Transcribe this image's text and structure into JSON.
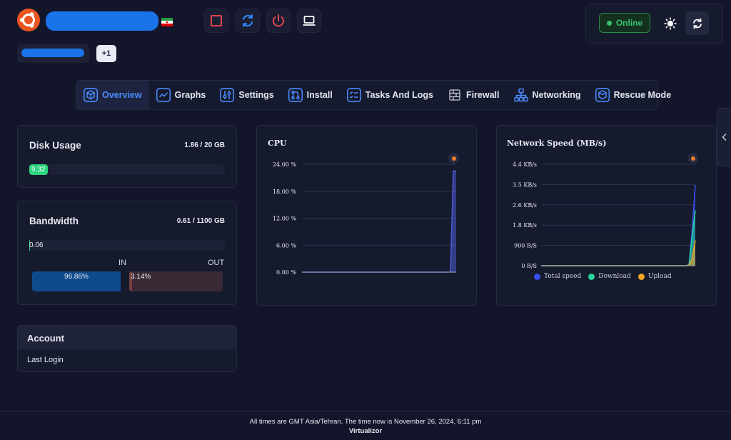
{
  "header": {
    "toolbar": [
      {
        "name": "stop-icon",
        "color": "#e0454f"
      },
      {
        "name": "restart-icon",
        "color": "#2f8cff"
      },
      {
        "name": "power-off-icon",
        "color": "#e0454f"
      },
      {
        "name": "vnc-icon",
        "color": "#ffffff"
      }
    ],
    "status": "Online",
    "extra_ips_badge": "+1"
  },
  "nav": [
    {
      "label": "Overview",
      "icon": "cube-icon",
      "active": true
    },
    {
      "label": "Graphs",
      "icon": "line-chart-icon"
    },
    {
      "label": "Settings",
      "icon": "sliders-icon"
    },
    {
      "label": "Install",
      "icon": "install-icon"
    },
    {
      "label": "Tasks And Logs",
      "icon": "tasks-icon"
    },
    {
      "label": "Firewall",
      "icon": "firewall-icon"
    },
    {
      "label": "Networking",
      "icon": "network-icon"
    },
    {
      "label": "Rescue Mode",
      "icon": "rescue-icon"
    }
  ],
  "disk": {
    "title": "Disk Usage",
    "meta": "1.86 / 20 GB",
    "percent_label": "9.32",
    "percent": 9.32
  },
  "bandwidth": {
    "title": "Bandwidth",
    "meta": "0.61 / 1100 GB",
    "percent_label": "0.06",
    "percent": 0.06,
    "in_label": "IN",
    "out_label": "OUT",
    "in_percent_label": "96.86%",
    "out_percent_label": "3.14%",
    "in_percent": 96.86,
    "out_percent": 3.14
  },
  "cpu_chart": {
    "title": "CPU",
    "chart_data": {
      "type": "area",
      "y_ticks": [
        "24.00 %",
        "18.00 %",
        "12.00 %",
        "6.00 %",
        "0.00 %"
      ],
      "ylim": [
        0,
        24
      ],
      "series": [
        {
          "values": [
            0,
            0,
            0,
            0,
            0,
            0,
            0,
            0,
            0,
            0,
            0,
            0,
            0,
            0,
            0,
            0,
            0,
            0,
            0,
            0,
            0,
            0,
            0,
            0,
            0,
            0,
            0,
            0,
            0,
            0,
            0,
            0,
            0,
            0,
            0,
            0,
            0,
            0,
            0,
            0,
            0,
            0,
            0,
            0,
            0,
            0,
            0,
            0,
            0,
            0,
            0,
            0,
            0,
            22.5,
            22.5
          ],
          "color": "#4c5bd4"
        }
      ]
    }
  },
  "net_chart": {
    "title": "Network Speed (MB/s)",
    "chart_data": {
      "type": "area",
      "y_ticks": [
        "4.4 KB/s",
        "3.5 KB/s",
        "2.6 KB/s",
        "1.8 KB/s",
        "900 B/S",
        "0 B/S"
      ],
      "ylim": [
        0,
        4.4
      ],
      "series": [
        {
          "name": "Total speed",
          "color": "#3b4ff0",
          "values": [
            0,
            0,
            0,
            0,
            0,
            0,
            0,
            0,
            0,
            0,
            0,
            0,
            0,
            0,
            0,
            0,
            0,
            0,
            0,
            0,
            0,
            0,
            0,
            0,
            0,
            0,
            0,
            0,
            0,
            0,
            0,
            0,
            0,
            0,
            0,
            0,
            0,
            0,
            0,
            0,
            0,
            0,
            0,
            0,
            0,
            0,
            0,
            0.05,
            1.6,
            3.5
          ]
        },
        {
          "name": "Download",
          "color": "#28d49a",
          "values": [
            0,
            0,
            0,
            0,
            0,
            0,
            0,
            0,
            0,
            0,
            0,
            0,
            0,
            0,
            0,
            0,
            0,
            0,
            0,
            0,
            0,
            0,
            0,
            0,
            0,
            0,
            0,
            0,
            0,
            0,
            0,
            0,
            0,
            0,
            0,
            0,
            0,
            0,
            0,
            0,
            0,
            0,
            0,
            0,
            0,
            0,
            0,
            0.04,
            1.3,
            2.4
          ]
        },
        {
          "name": "Upload",
          "color": "#f5a623",
          "values": [
            0,
            0,
            0,
            0,
            0,
            0,
            0,
            0,
            0,
            0,
            0,
            0,
            0,
            0,
            0,
            0,
            0,
            0,
            0,
            0,
            0,
            0,
            0,
            0,
            0,
            0,
            0,
            0,
            0,
            0,
            0,
            0,
            0,
            0,
            0,
            0,
            0,
            0,
            0,
            0,
            0,
            0,
            0,
            0,
            0,
            0,
            0,
            0.01,
            0.3,
            1.1
          ]
        }
      ]
    }
  },
  "account": {
    "title": "Account",
    "last_login": "Last Login"
  },
  "footer": {
    "line1": "All times are GMT Asia/Tehran. The time now is November 26, 2024, 6:11 pm",
    "line2": "Virtualizor"
  }
}
